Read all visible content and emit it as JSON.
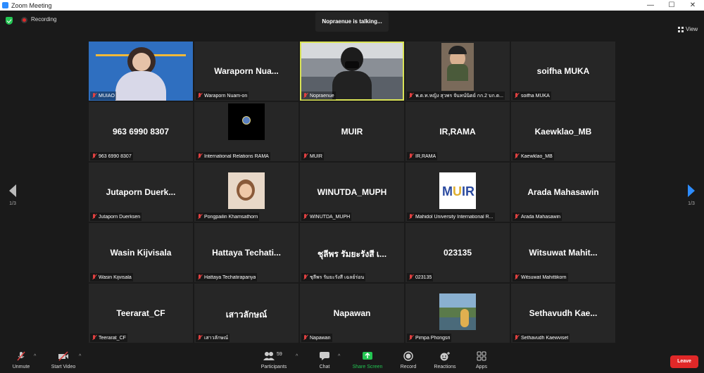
{
  "window": {
    "title": "Zoom Meeting",
    "controls": [
      "—",
      "☐",
      "✕"
    ]
  },
  "topbar": {
    "recording_label": "Recording",
    "talking_banner": "Nopraenue is talking...",
    "view_label": "View"
  },
  "pager": {
    "left_page": "1/3",
    "right_page": "1/3"
  },
  "participants": [
    {
      "display": "",
      "label": "MUIAO",
      "type": "video",
      "speaking": false
    },
    {
      "display": "Waraporn Nua...",
      "label": "Waraporn Nuam-on",
      "type": "name",
      "speaking": false
    },
    {
      "display": "",
      "label": "Nopraenue",
      "type": "video",
      "speaking": true
    },
    {
      "display": "",
      "label": "พ.ต.ท.หญิง สุวพร จันทน์นิตย์ กก.2 บก.ต...",
      "type": "photo",
      "speaking": false
    },
    {
      "display": "soifha MUKA",
      "label": "soifha MUKA",
      "type": "name",
      "speaking": false
    },
    {
      "display": "963 6990 8307",
      "label": "963 6990 8307",
      "type": "name",
      "speaking": false
    },
    {
      "display": "",
      "label": "International Relations RAMA",
      "type": "logo",
      "speaking": false
    },
    {
      "display": "MUIR",
      "label": "MUIR",
      "type": "name",
      "speaking": false
    },
    {
      "display": "IR,RAMA",
      "label": "IR,RAMA",
      "type": "name",
      "speaking": false
    },
    {
      "display": "Kaewklao_MB",
      "label": "Kaewklao_MB",
      "type": "name",
      "speaking": false
    },
    {
      "display": "Jutaporn Duerk...",
      "label": "Jutaporn Duerksen",
      "type": "name",
      "speaking": false
    },
    {
      "display": "",
      "label": "Pongpailin Khamsathorn",
      "type": "photo",
      "speaking": false
    },
    {
      "display": "WINUTDA_MUPH",
      "label": "WINUTDA_MUPH",
      "type": "name",
      "speaking": false
    },
    {
      "display": "",
      "label": "Mahidol University International R...",
      "type": "muir-logo",
      "speaking": false
    },
    {
      "display": "Arada Mahasawin",
      "label": "Arada Mahasawin",
      "type": "name",
      "speaking": false
    },
    {
      "display": "Wasin Kijvisala",
      "label": "Wasin Kijvisala",
      "type": "name",
      "speaking": false
    },
    {
      "display": "Hattaya Techati...",
      "label": "Hattaya Techatirapanya",
      "type": "name",
      "speaking": false
    },
    {
      "display": "ชุลีพร รัมยะรังสี เ...",
      "label": "ชุลีพร รัมยะรังสี เฉลย์ร่อน",
      "type": "name",
      "speaking": false
    },
    {
      "display": "023135",
      "label": "023135",
      "type": "name",
      "speaking": false
    },
    {
      "display": "Witsuwat Mahit...",
      "label": "Witsuwat Mahittikorn",
      "type": "name",
      "speaking": false
    },
    {
      "display": "Teerarat_CF",
      "label": "Teerarat_CF",
      "type": "name",
      "speaking": false
    },
    {
      "display": "เสาวลักษณ์",
      "label": "เสาวลักษณ์",
      "type": "name",
      "speaking": false
    },
    {
      "display": "Napawan",
      "label": "Napawan",
      "type": "name",
      "speaking": false
    },
    {
      "display": "",
      "label": "Pimpa Phongsri",
      "type": "photo",
      "speaking": false
    },
    {
      "display": "Sethavudh Kae...",
      "label": "Sethavudh Kaewviset",
      "type": "name",
      "speaking": false
    }
  ],
  "toolbar": {
    "unmute": "Unmute",
    "start_video": "Start Video",
    "participants": "Participants",
    "participants_count": "59",
    "chat": "Chat",
    "share_screen": "Share Screen",
    "record": "Record",
    "reactions": "Reactions",
    "apps": "Apps",
    "leave": "Leave"
  },
  "colors": {
    "accent_blue": "#2d8cff",
    "speaking_border": "#d9e356",
    "share_green": "#23c552",
    "leave_red": "#e02828",
    "tile_bg": "#262626"
  }
}
